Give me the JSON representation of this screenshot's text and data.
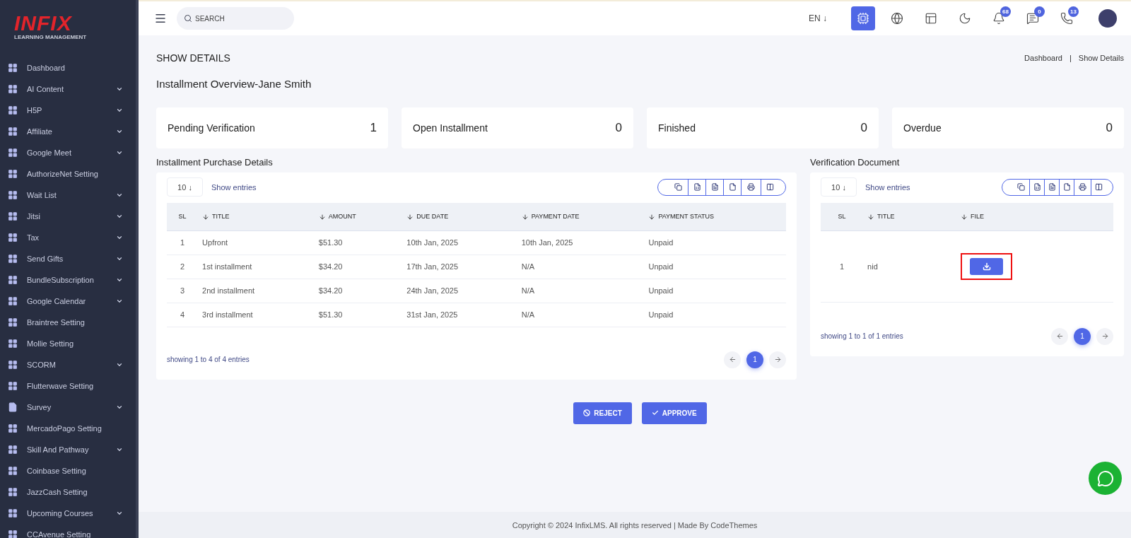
{
  "logo": {
    "title": "INFIX",
    "subtitle": "LEARNING MANAGEMENT"
  },
  "sidebar": {
    "items": [
      {
        "label": "Dashboard",
        "kind": "grid",
        "expandable": false
      },
      {
        "label": "AI Content",
        "kind": "grid",
        "expandable": true
      },
      {
        "label": "H5P",
        "kind": "grid",
        "expandable": true
      },
      {
        "label": "Affiliate",
        "kind": "grid",
        "expandable": true
      },
      {
        "label": "Google Meet",
        "kind": "grid",
        "expandable": true
      },
      {
        "label": "AuthorizeNet Setting",
        "kind": "grid",
        "expandable": false
      },
      {
        "label": "Wait List",
        "kind": "grid",
        "expandable": true
      },
      {
        "label": "Jitsi",
        "kind": "grid",
        "expandable": true
      },
      {
        "label": "Tax",
        "kind": "grid",
        "expandable": true
      },
      {
        "label": "Send Gifts",
        "kind": "grid",
        "expandable": true
      },
      {
        "label": "BundleSubscription",
        "kind": "grid",
        "expandable": true
      },
      {
        "label": "Google Calendar",
        "kind": "grid",
        "expandable": true
      },
      {
        "label": "Braintree Setting",
        "kind": "grid",
        "expandable": false
      },
      {
        "label": "Mollie Setting",
        "kind": "grid",
        "expandable": false
      },
      {
        "label": "SCORM",
        "kind": "grid",
        "expandable": true
      },
      {
        "label": "Flutterwave Setting",
        "kind": "grid",
        "expandable": false
      },
      {
        "label": "Survey",
        "kind": "doc",
        "expandable": true
      },
      {
        "label": "MercadoPago Setting",
        "kind": "grid",
        "expandable": false
      },
      {
        "label": "Skill And Pathway",
        "kind": "grid",
        "expandable": true
      },
      {
        "label": "Coinbase Setting",
        "kind": "grid",
        "expandable": false
      },
      {
        "label": "JazzCash Setting",
        "kind": "grid",
        "expandable": false
      },
      {
        "label": "Upcoming Courses",
        "kind": "grid",
        "expandable": true
      },
      {
        "label": "CCAvenue Setting",
        "kind": "grid",
        "expandable": false
      }
    ]
  },
  "topbar": {
    "search": {
      "placeholder": "SEARCH"
    },
    "language": "EN ↓",
    "icons": [
      {
        "kind": "ai"
      },
      {
        "kind": "globe"
      },
      {
        "kind": "layout"
      },
      {
        "kind": "moon"
      },
      {
        "kind": "bell",
        "badge": "68"
      },
      {
        "kind": "chat",
        "badge": "0"
      },
      {
        "kind": "phone",
        "badge": "13"
      }
    ]
  },
  "page": {
    "title": "SHOW DETAILS",
    "breadcrumb": [
      "Dashboard",
      "|",
      "Show Details"
    ],
    "subtitle": "Installment Overview-Jane Smith"
  },
  "stats": [
    {
      "label": "Pending Verification",
      "value": "1"
    },
    {
      "label": "Open Installment",
      "value": "0"
    },
    {
      "label": "Finished",
      "value": "0"
    },
    {
      "label": "Overdue",
      "value": "0"
    }
  ],
  "purchase_table": {
    "heading": "Installment Purchase Details",
    "page_size": "10 ↓",
    "show_entries": "Show entries",
    "columns": [
      {
        "label": "SL",
        "sortable": false
      },
      {
        "label": "TITLE",
        "sortable": true
      },
      {
        "label": "AMOUNT",
        "sortable": true
      },
      {
        "label": "DUE DATE",
        "sortable": true
      },
      {
        "label": "PAYMENT DATE",
        "sortable": true
      },
      {
        "label": "PAYMENT STATUS",
        "sortable": true
      }
    ],
    "rows": [
      [
        "1",
        "Upfront",
        "$51.30",
        "10th Jan, 2025",
        "10th Jan, 2025",
        "Unpaid"
      ],
      [
        "2",
        "1st installment",
        "$34.20",
        "17th Jan, 2025",
        "N/A",
        "Unpaid"
      ],
      [
        "3",
        "2nd installment",
        "$34.20",
        "24th Jan, 2025",
        "N/A",
        "Unpaid"
      ],
      [
        "4",
        "3rd installment",
        "$51.30",
        "31st Jan, 2025",
        "N/A",
        "Unpaid"
      ]
    ],
    "info": "showing 1 to 4 of 4 entries",
    "pages": [
      {
        "label": "1",
        "selected": true
      }
    ]
  },
  "document_table": {
    "heading": "Verification Document",
    "page_size": "10 ↓",
    "show_entries": "Show entries",
    "columns": [
      {
        "label": "SL",
        "sortable": false
      },
      {
        "label": "TITLE",
        "sortable": true
      },
      {
        "label": "FILE",
        "sortable": true
      }
    ],
    "rows": [
      {
        "sl": "1",
        "title": "nid",
        "highlighted": true
      }
    ],
    "info": "showing 1 to 1 of 1 entries",
    "pages": [
      {
        "label": "1",
        "selected": true
      }
    ]
  },
  "actions": [
    {
      "kind": "reject",
      "label": "REJECT"
    },
    {
      "kind": "approve",
      "label": "APPROVE"
    }
  ],
  "footer": "Copyright © 2024 InfixLMS. All rights reserved | Made By CodeThemes"
}
